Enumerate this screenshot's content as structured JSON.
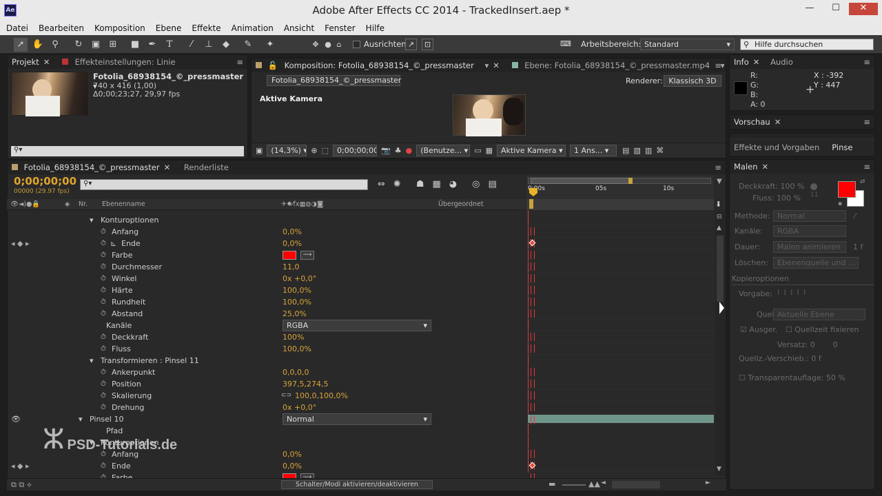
{
  "window": {
    "title": "Adobe After Effects CC 2014 - TrackedInsert.aep *",
    "app_icon": "Ae"
  },
  "menu": [
    "Datei",
    "Bearbeiten",
    "Komposition",
    "Ebene",
    "Effekte",
    "Animation",
    "Ansicht",
    "Fenster",
    "Hilfe"
  ],
  "toolbar": {
    "align_label": "Ausrichten",
    "workspace_label": "Arbeitsbereich:",
    "workspace_value": "Standard",
    "search_placeholder": "Hilfe durchsuchen"
  },
  "project": {
    "tab": "Projekt",
    "effects_tab": "Effekteinstellungen: Linie",
    "file_name": "Fotolia_68938154_©_pressmaster",
    "dims": "740 x 416 (1,00)",
    "duration": "Δ0;00;23;27, 29,97 fps",
    "search_icon": "search-icon"
  },
  "comp_viewer": {
    "tab_comp": "Komposition: Fotolia_68938154_©_pressmaster",
    "tab_layer": "Ebene: Fotolia_68938154_©_pressmaster.mp4",
    "breadcrumb": "Fotolia_68938154_©_pressmaster",
    "renderer_label": "Renderer:",
    "renderer_value": "Klassisch 3D",
    "camera_label": "Aktive Kamera",
    "zoom": "(14,3%)",
    "timecode": "0;00;00;00",
    "resolution": "(Benutze...",
    "camera_select": "Aktive Kamera",
    "views": "1 Ans..."
  },
  "info": {
    "tab_info": "Info",
    "tab_audio": "Audio",
    "r": "R:",
    "g": "G:",
    "b": "B:",
    "a": "A:",
    "a_val": "0",
    "x": "X : -392",
    "y": "Y : 447"
  },
  "preview": {
    "tab": "Vorschau"
  },
  "effects_presets": {
    "tab": "Effekte und Vorgaben",
    "tab2": "Pinse"
  },
  "paint": {
    "tab": "Malen",
    "opacity_label": "Deckkraft:",
    "opacity": "100 %",
    "flow_label": "Fluss:",
    "flow": "100 %",
    "brush_size": "11",
    "mode_label": "Methode:",
    "mode": "Normal",
    "channels_label": "Kanäle:",
    "channels": "RGBA",
    "duration_label": "Dauer:",
    "duration": "Malen animieren",
    "frames": "1 f",
    "erase_label": "Löschen:",
    "erase": "Ebenenquelle und ...",
    "clone_header": "Kopieroptionen",
    "preset_label": "Vorgabe:",
    "source_label": "Quelle:",
    "source": "Aktuelle Ebene",
    "aligned": "Ausger.",
    "lock_source": "Quellzeit fixieren",
    "offset_label": "Versatz:",
    "offset_x": "0",
    "offset_y": "0",
    "time_shift_label": "Quellz.-Verschieb.:",
    "time_shift": "0 f",
    "overlay_label": "Transparentauflage:",
    "overlay": "50 %",
    "fg_color": "#ff0000",
    "bg_color": "#ffffff"
  },
  "timeline": {
    "tab": "Fotolia_68938154_©_pressmaster",
    "render_tab": "Renderliste",
    "timecode": "0;00;00;00",
    "frames": "00000 (29.97 fps)",
    "col_nr": "Nr.",
    "col_name": "Ebenenname",
    "col_parent": "Übergeordnet",
    "ruler": [
      "0:00s",
      "05s",
      "10s"
    ],
    "toggle_label": "Schalter/Modi aktivieren/deaktivieren",
    "rows": [
      {
        "indent": 1,
        "twirl": true,
        "label": "Konturoptionen",
        "value": ""
      },
      {
        "indent": 2,
        "watch": true,
        "label": "Anfang",
        "value": "0,0%"
      },
      {
        "indent": 2,
        "watch": true,
        "graph": true,
        "key": true,
        "label": "Ende",
        "value": "0,0%"
      },
      {
        "indent": 2,
        "watch": true,
        "label": "Farbe",
        "value": "",
        "color": "#ff0000"
      },
      {
        "indent": 2,
        "watch": true,
        "label": "Durchmesser",
        "value": "11,0"
      },
      {
        "indent": 2,
        "watch": true,
        "label": "Winkel",
        "value": "0x +0,0°"
      },
      {
        "indent": 2,
        "watch": true,
        "label": "Härte",
        "value": "100,0%"
      },
      {
        "indent": 2,
        "watch": true,
        "label": "Rundheit",
        "value": "100,0%"
      },
      {
        "indent": 2,
        "watch": true,
        "label": "Abstand",
        "value": "25,0%"
      },
      {
        "indent": 1.5,
        "label": "Kanäle",
        "dropdown": "RGBA"
      },
      {
        "indent": 2,
        "watch": true,
        "label": "Deckkraft",
        "value": "100%"
      },
      {
        "indent": 2,
        "watch": true,
        "label": "Fluss",
        "value": "100,0%"
      },
      {
        "indent": 1,
        "twirl": true,
        "label": "Transformieren : Pinsel 11",
        "value": ""
      },
      {
        "indent": 2,
        "watch": true,
        "label": "Ankerpunkt",
        "value": "0,0,0,0"
      },
      {
        "indent": 2,
        "watch": true,
        "label": "Position",
        "value": "397,5,274,5"
      },
      {
        "indent": 2,
        "watch": true,
        "label": "Skalierung",
        "value": "100,0,100,0%",
        "link": true
      },
      {
        "indent": 2,
        "watch": true,
        "label": "Drehung",
        "value": "0x +0,0°"
      },
      {
        "indent": 0,
        "twirl": true,
        "eye": true,
        "label": "Pinsel 10",
        "dropdown": "Normal",
        "bar": true
      },
      {
        "indent": 1.5,
        "label": "Pfad",
        "value": ""
      },
      {
        "indent": 1,
        "twirl": true,
        "label": "Konturoptionen",
        "value": ""
      },
      {
        "indent": 2,
        "watch": true,
        "label": "Anfang",
        "value": "0,0%"
      },
      {
        "indent": 2,
        "watch": true,
        "key": true,
        "label": "Ende",
        "value": "0,0%"
      },
      {
        "indent": 2,
        "watch": true,
        "label": "Farbe",
        "value": "",
        "color": "#ff0000"
      }
    ]
  },
  "watermark": "PSD-Tutorials.de"
}
